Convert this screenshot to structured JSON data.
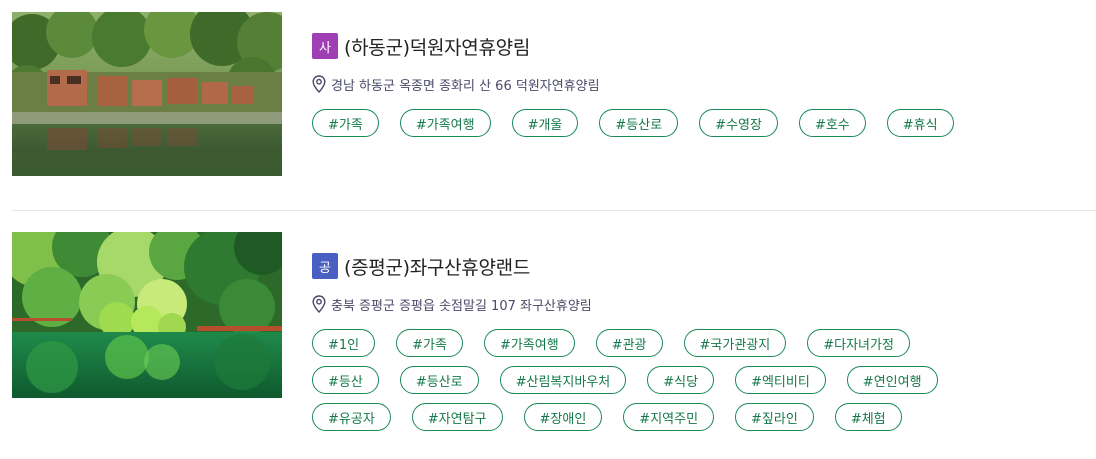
{
  "items": [
    {
      "badge": "사",
      "badge_color": "#a03fb5",
      "title": "(하동군)덕원자연휴양림",
      "address": "경남 하동군 옥종면 종화리 산 66 덕원자연휴양림",
      "image": "lake-cabins-photo",
      "tags": [
        "#가족",
        "#가족여행",
        "#개울",
        "#등산로",
        "#수영장",
        "#호수",
        "#휴식"
      ]
    },
    {
      "badge": "공",
      "badge_color": "#4a5fc2",
      "title": "(증평군)좌구산휴양랜드",
      "address": "충북 증평군 증평읍 솟점말길 107 좌구산휴양림",
      "image": "green-lake-forest-photo",
      "tags": [
        "#1인",
        "#가족",
        "#가족여행",
        "#관광",
        "#국가관광지",
        "#다자녀가정",
        "#등산",
        "#등산로",
        "#산림복지바우처",
        "#식당",
        "#엑티비티",
        "#연인여행",
        "#유공자",
        "#자연탐구",
        "#장애인",
        "#지역주민",
        "#짚라인",
        "#체험"
      ]
    }
  ],
  "colors": {
    "tag_border": "#1a8a57",
    "tag_text": "#15794b",
    "address_text": "#4a4a6a"
  }
}
